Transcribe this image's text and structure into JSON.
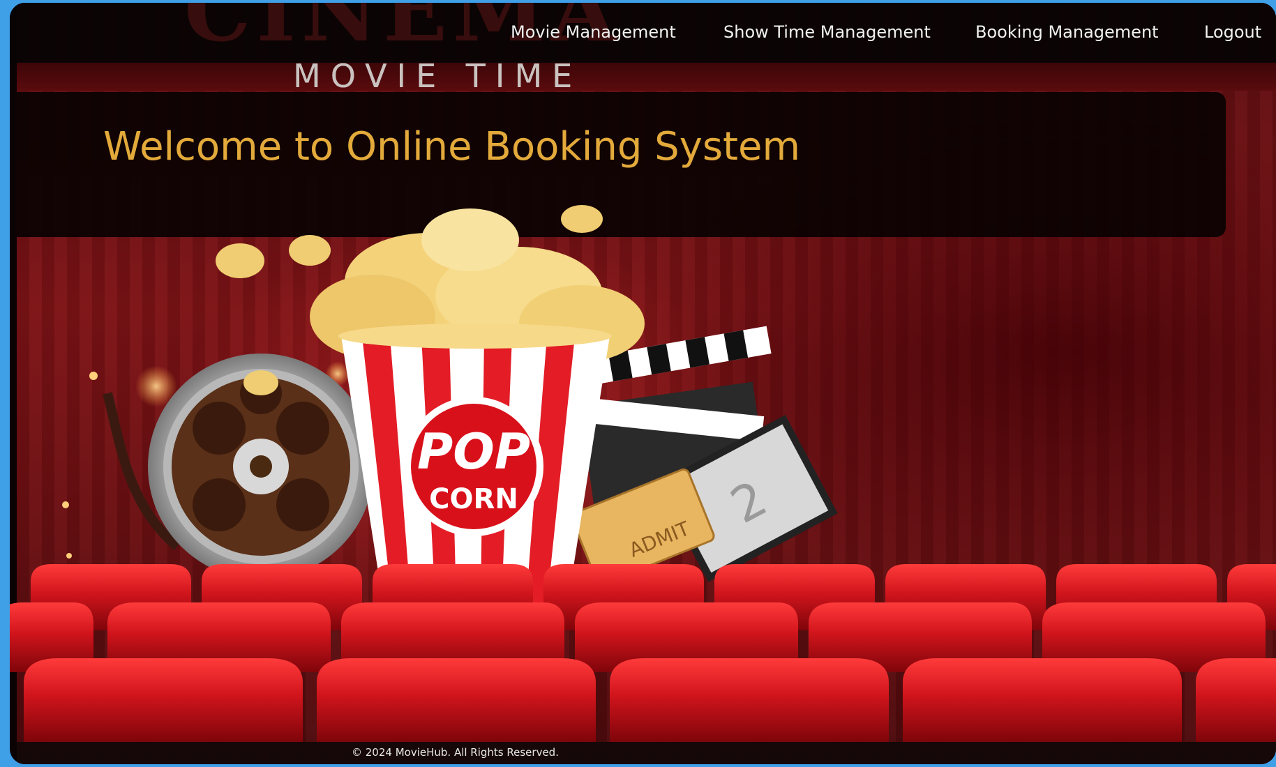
{
  "brand": {
    "ghost_title": "CINEMA",
    "subtitle": "MOVIE TIME"
  },
  "nav": {
    "items": [
      {
        "label": "Movie Management"
      },
      {
        "label": "Show Time Management"
      },
      {
        "label": "Booking Management"
      },
      {
        "label": "Logout"
      }
    ]
  },
  "welcome": {
    "title": "Welcome to Online Booking System"
  },
  "hero": {
    "popcorn_top": "POP",
    "popcorn_bottom": "CORN",
    "ticket_text": "ADMIT",
    "clapper_number": "2"
  },
  "footer": {
    "copyright": "© 2024 MovieHub. All Rights Reserved."
  },
  "colors": {
    "accent": "#e3aa3b",
    "nav_bg": "#080404",
    "seat_red": "#d0141c",
    "frame_blue": "#3fa0e8"
  }
}
